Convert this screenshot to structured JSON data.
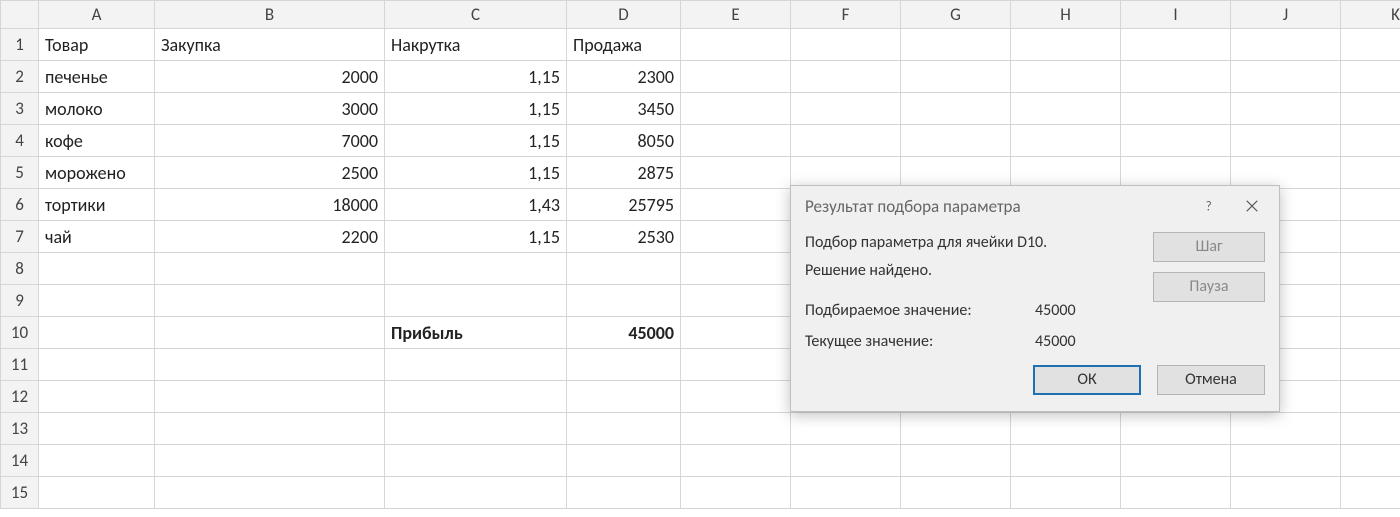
{
  "columns": [
    "A",
    "B",
    "C",
    "D",
    "E",
    "F",
    "G",
    "H",
    "I",
    "J",
    "K"
  ],
  "row_count": 15,
  "headers": {
    "A1": "Товар",
    "B1": "Закупка",
    "C1": "Накрутка",
    "D1": "Продажа"
  },
  "data_rows": [
    {
      "A": "печенье",
      "B": "2000",
      "C": "1,15",
      "D": "2300"
    },
    {
      "A": "молоко",
      "B": "3000",
      "C": "1,15",
      "D": "3450"
    },
    {
      "A": "кофе",
      "B": "7000",
      "C": "1,15",
      "D": "8050"
    },
    {
      "A": "морожено",
      "B": "2500",
      "C": "1,15",
      "D": "2875"
    },
    {
      "A": "тортики",
      "B": "18000",
      "C": "1,43",
      "D": "25795"
    },
    {
      "A": "чай",
      "B": "2200",
      "C": "1,15",
      "D": "2530"
    }
  ],
  "summary": {
    "row": 10,
    "C": "Прибыль",
    "D": "45000"
  },
  "dialog": {
    "title": "Результат подбора параметра",
    "msg1": "Подбор параметра для ячейки D10.",
    "msg2": "Решение найдено.",
    "target_label": "Подбираемое значение:",
    "target_value": "45000",
    "current_label": "Текущее значение:",
    "current_value": "45000",
    "step_label": "Шаг",
    "pause_label": "Пауза",
    "ok_label": "ОК",
    "cancel_label": "Отмена"
  }
}
